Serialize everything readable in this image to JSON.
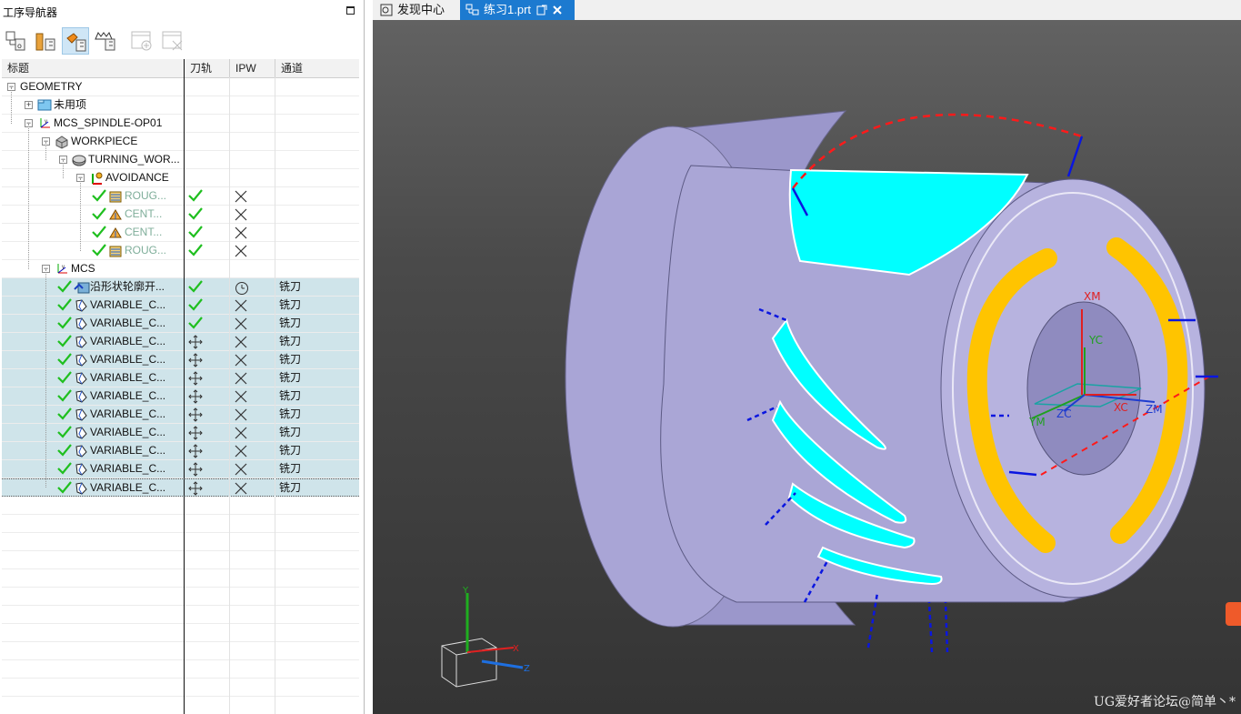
{
  "navigator": {
    "title": "工序导航器",
    "toolbar": [
      {
        "icon": "program-order-view-icon"
      },
      {
        "icon": "machine-tool-view-icon"
      },
      {
        "icon": "geometry-view-icon",
        "active": true
      },
      {
        "icon": "machining-method-view-icon"
      },
      {
        "icon": "create-operation-icon",
        "disabled": true
      },
      {
        "icon": "delete-operation-icon",
        "disabled": true
      }
    ],
    "columns": [
      "标题",
      "刀轨",
      "IPW",
      "通道"
    ],
    "rows": [
      {
        "indent": 0,
        "exp": "-",
        "icon": "none",
        "name": "GEOMETRY"
      },
      {
        "indent": 1,
        "exp": "+",
        "icon": "folder",
        "name": "未用项"
      },
      {
        "indent": 1,
        "exp": "-",
        "icon": "mcs",
        "name": "MCS_SPINDLE-OP01"
      },
      {
        "indent": 2,
        "exp": "-",
        "icon": "workpiece",
        "name": "WORKPIECE"
      },
      {
        "indent": 3,
        "exp": "-",
        "icon": "turning",
        "name": "TURNING_WOR..."
      },
      {
        "indent": 4,
        "exp": "-",
        "icon": "avoidance",
        "name": "AVOIDANCE"
      },
      {
        "indent": 5,
        "check": true,
        "icon": "rough",
        "name": "ROUG...",
        "dim": true,
        "path": "check",
        "ipw": "x",
        "channel": ""
      },
      {
        "indent": 5,
        "check": true,
        "icon": "center",
        "name": "CENT...",
        "dim": true,
        "path": "check",
        "ipw": "x",
        "channel": ""
      },
      {
        "indent": 5,
        "check": true,
        "icon": "center",
        "name": "CENT...",
        "dim": true,
        "path": "check",
        "ipw": "x",
        "channel": ""
      },
      {
        "indent": 5,
        "check": true,
        "icon": "rough",
        "name": "ROUG...",
        "dim": true,
        "path": "check",
        "ipw": "x",
        "channel": ""
      },
      {
        "indent": 2,
        "exp": "-",
        "icon": "mcs",
        "name": "MCS"
      },
      {
        "indent": 3,
        "check": true,
        "icon": "contour",
        "name": "沿形状轮廓开...",
        "path": "check",
        "ipw": "clock",
        "channel": "铣刀",
        "sel": true
      },
      {
        "indent": 3,
        "check": true,
        "icon": "variable",
        "name": "VARIABLE_C...",
        "path": "check",
        "ipw": "x",
        "channel": "铣刀",
        "sel": true
      },
      {
        "indent": 3,
        "check": true,
        "icon": "variable",
        "name": "VARIABLE_C...",
        "path": "check",
        "ipw": "x",
        "channel": "铣刀",
        "sel": true
      },
      {
        "indent": 3,
        "check": true,
        "icon": "variable",
        "name": "VARIABLE_C...",
        "path": "move",
        "ipw": "x",
        "channel": "铣刀",
        "sel": true
      },
      {
        "indent": 3,
        "check": true,
        "icon": "variable",
        "name": "VARIABLE_C...",
        "path": "move",
        "ipw": "x",
        "channel": "铣刀",
        "sel": true
      },
      {
        "indent": 3,
        "check": true,
        "icon": "variable",
        "name": "VARIABLE_C...",
        "path": "move",
        "ipw": "x",
        "channel": "铣刀",
        "sel": true
      },
      {
        "indent": 3,
        "check": true,
        "icon": "variable",
        "name": "VARIABLE_C...",
        "path": "move",
        "ipw": "x",
        "channel": "铣刀",
        "sel": true
      },
      {
        "indent": 3,
        "check": true,
        "icon": "variable",
        "name": "VARIABLE_C...",
        "path": "move",
        "ipw": "x",
        "channel": "铣刀",
        "sel": true
      },
      {
        "indent": 3,
        "check": true,
        "icon": "variable",
        "name": "VARIABLE_C...",
        "path": "move",
        "ipw": "x",
        "channel": "铣刀",
        "sel": true
      },
      {
        "indent": 3,
        "check": true,
        "icon": "variable",
        "name": "VARIABLE_C...",
        "path": "move",
        "ipw": "x",
        "channel": "铣刀",
        "sel": true
      },
      {
        "indent": 3,
        "check": true,
        "icon": "variable",
        "name": "VARIABLE_C...",
        "path": "move",
        "ipw": "x",
        "channel": "铣刀",
        "sel": true
      },
      {
        "indent": 3,
        "check": true,
        "icon": "variable",
        "name": "VARIABLE_C...",
        "path": "move",
        "ipw": "x",
        "channel": "铣刀",
        "sel": true,
        "last": true
      }
    ]
  },
  "tabs": [
    {
      "label": "发现中心",
      "icon": "discovery-icon"
    },
    {
      "label": "练习1.prt",
      "icon": "part-file-icon",
      "active": true
    }
  ],
  "viewport": {
    "csys_labels": [
      "XM",
      "YC",
      "ZC",
      "XC",
      "YM",
      "ZM"
    ],
    "triad_labels": [
      "Y",
      "X",
      "Z"
    ],
    "watermark": "UG爱好者论坛@简单丶*",
    "colors": {
      "part": "#aaa6d6",
      "cyan": "#00ffff",
      "yellow": "#ffc400",
      "path_red": "#ff1a1a",
      "path_blue": "#0a16e0",
      "selection": "#cfe4ea",
      "tab_active": "#1c7ad0"
    }
  }
}
